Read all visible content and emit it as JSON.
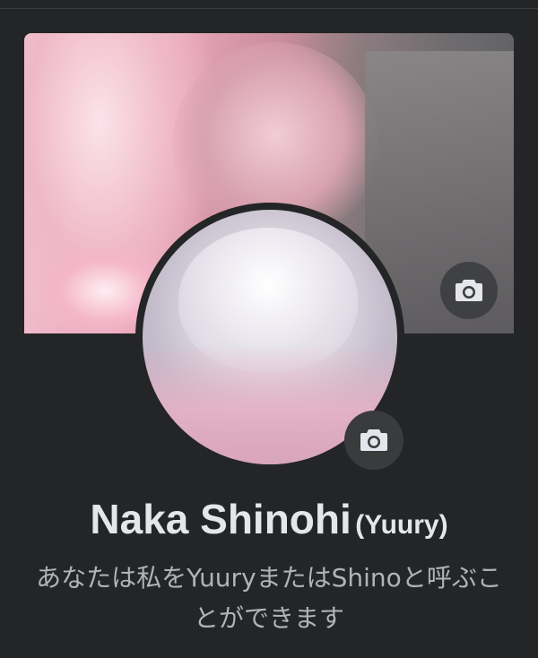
{
  "profile": {
    "name": "Naka Shinohi",
    "alternate_name": "(Yuury)",
    "bio": "あなたは私をYuuryまたはShinoと呼ぶことができます"
  },
  "icons": {
    "cover_camera": "camera-icon",
    "avatar_camera": "camera-icon"
  },
  "colors": {
    "background": "#242526",
    "primary_text": "#e4e6eb",
    "secondary_text": "#b0b3b8",
    "button_bg": "#3a3b3c"
  }
}
